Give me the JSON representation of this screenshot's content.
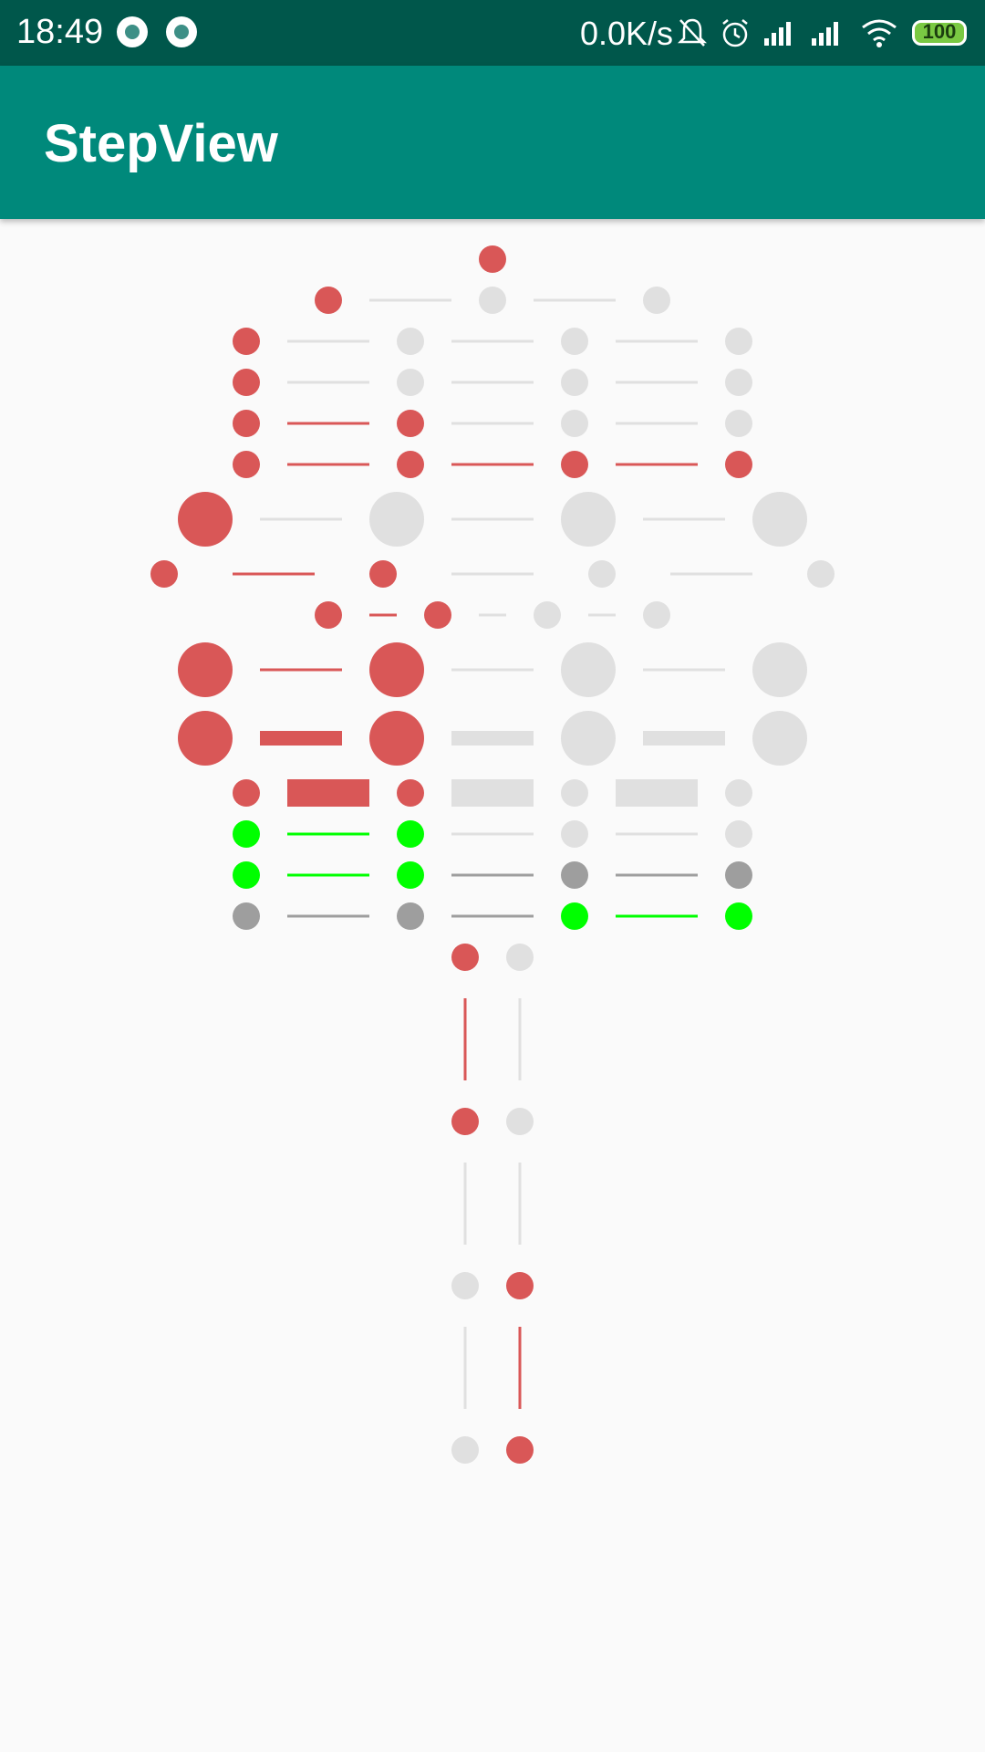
{
  "status_bar": {
    "time": "18:49",
    "network_speed": "0.0K/s",
    "battery": "100",
    "icons": [
      "notification-dot-icon",
      "notification-dot-icon",
      "mute-bell-icon",
      "alarm-icon",
      "signal-icon",
      "signal-icon",
      "wifi-icon",
      "battery-icon"
    ]
  },
  "app_bar": {
    "title": "StepView"
  },
  "colors": {
    "active": "#d95757",
    "inactive": "#e0e0e0",
    "green": "#00ff00",
    "gray": "#9e9e9e"
  },
  "step_views": [
    {
      "orientation": "horizontal",
      "step_count": 1,
      "current_step": 1,
      "done_color": "active",
      "undone_color": "inactive",
      "line_done_color": "active",
      "line_undone_color": "inactive",
      "dot_style": "small",
      "line_style": "thin"
    },
    {
      "orientation": "horizontal",
      "step_count": 3,
      "current_step": 1,
      "done_color": "active",
      "undone_color": "inactive",
      "line_done_color": "active",
      "line_undone_color": "inactive",
      "dot_style": "small",
      "line_style": "thin"
    },
    {
      "orientation": "horizontal",
      "step_count": 4,
      "current_step": 1,
      "done_color": "active",
      "undone_color": "inactive",
      "line_done_color": "inactive",
      "line_undone_color": "inactive",
      "dot_style": "small",
      "line_style": "thin"
    },
    {
      "orientation": "horizontal",
      "step_count": 4,
      "current_step": 1,
      "done_color": "active",
      "undone_color": "inactive",
      "line_done_color": "active",
      "line_undone_color": "inactive",
      "dot_style": "small",
      "line_style": "thin"
    },
    {
      "orientation": "horizontal",
      "step_count": 4,
      "current_step": 2,
      "done_color": "active",
      "undone_color": "inactive",
      "line_done_color": "active",
      "line_undone_color": "inactive",
      "dot_style": "small",
      "line_style": "thin"
    },
    {
      "orientation": "horizontal",
      "step_count": 4,
      "current_step": 4,
      "done_color": "active",
      "undone_color": "inactive",
      "line_done_color": "active",
      "line_undone_color": "inactive",
      "dot_style": "small",
      "line_style": "thin"
    },
    {
      "orientation": "horizontal",
      "step_count": 4,
      "current_step": 1,
      "done_color": "active",
      "undone_color": "inactive",
      "line_done_color": "active",
      "line_undone_color": "inactive",
      "dot_style": "large",
      "line_style": "thin"
    },
    {
      "orientation": "horizontal",
      "step_count": 4,
      "current_step": 2,
      "done_color": "active",
      "undone_color": "inactive",
      "line_done_color": "active",
      "line_undone_color": "inactive",
      "dot_style": "small",
      "line_style": "thin",
      "spacing": "wide"
    },
    {
      "orientation": "horizontal",
      "step_count": 4,
      "current_step": 2,
      "done_color": "active",
      "undone_color": "inactive",
      "line_done_color": "active",
      "line_undone_color": "inactive",
      "dot_style": "small",
      "line_style": "short"
    },
    {
      "orientation": "horizontal",
      "step_count": 4,
      "current_step": 2,
      "done_color": "active",
      "undone_color": "inactive",
      "line_done_color": "active",
      "line_undone_color": "inactive",
      "dot_style": "large",
      "line_style": "thin"
    },
    {
      "orientation": "horizontal",
      "step_count": 4,
      "current_step": 2,
      "done_color": "active",
      "undone_color": "inactive",
      "line_done_color": "active",
      "line_undone_color": "inactive",
      "dot_style": "large",
      "line_style": "medium"
    },
    {
      "orientation": "horizontal",
      "step_count": 4,
      "current_step": 2,
      "done_color": "active",
      "undone_color": "inactive",
      "line_done_color": "active",
      "line_undone_color": "inactive",
      "dot_style": "small",
      "line_style": "thick"
    },
    {
      "orientation": "horizontal",
      "step_count": 4,
      "current_step": 2,
      "done_color": "green",
      "undone_color": "inactive",
      "line_done_color": "green",
      "line_undone_color": "inactive",
      "dot_style": "small",
      "line_style": "thin"
    },
    {
      "orientation": "horizontal",
      "step_count": 4,
      "current_step": 2,
      "done_color": "green",
      "undone_color": "gray",
      "line_done_color": "green",
      "line_undone_color": "gray",
      "dot_style": "small",
      "line_style": "thin"
    },
    {
      "orientation": "horizontal",
      "step_count": 4,
      "current_step": 2,
      "reversed": true,
      "done_color": "green",
      "undone_color": "gray",
      "line_done_color": "green",
      "line_undone_color": "gray",
      "dot_style": "small",
      "line_style": "thin"
    },
    {
      "orientation": "vertical",
      "step_count": 4,
      "current_step": 2,
      "done_color": "active",
      "undone_color": "inactive",
      "line_done_color": "active",
      "line_undone_color": "inactive",
      "dot_style": "small",
      "line_style": "thin"
    },
    {
      "orientation": "vertical",
      "step_count": 4,
      "current_step": 2,
      "reversed": true,
      "done_color": "active",
      "undone_color": "inactive",
      "line_done_color": "active",
      "line_undone_color": "inactive",
      "dot_style": "small",
      "line_style": "thin"
    }
  ]
}
